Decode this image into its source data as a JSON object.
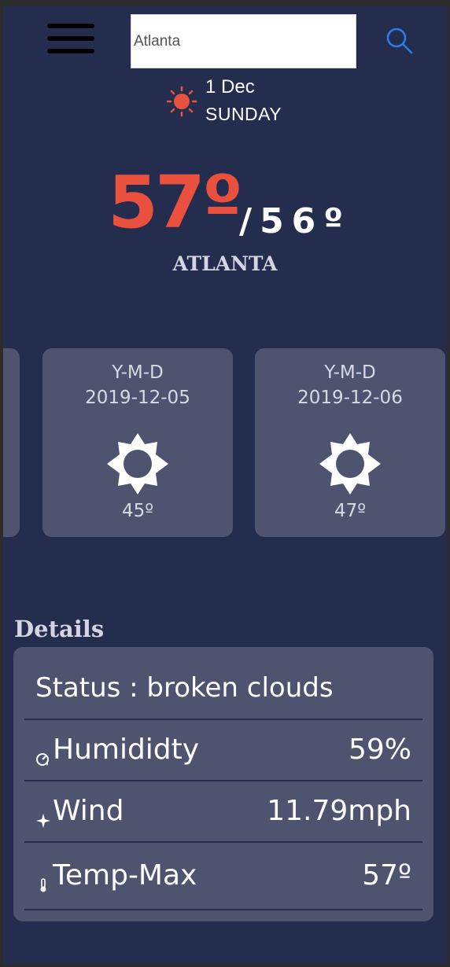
{
  "header": {
    "menu_icon": "hamburger-menu-icon",
    "search_value": "Atlanta",
    "search_icon": "search-icon"
  },
  "today": {
    "icon": "sun-icon",
    "day": "1 Dec",
    "weekday": "SUNDAY",
    "temp_current": "57º",
    "temp_min": "/56º",
    "city": "ATLANTA"
  },
  "forecast": [
    {
      "label": "Y-M-D",
      "date": "2019-12-05",
      "icon": "sun-icon",
      "temp": "45º"
    },
    {
      "label": "Y-M-D",
      "date": "2019-12-06",
      "icon": "sun-icon",
      "temp": "47º"
    }
  ],
  "details": {
    "title": "Details",
    "status": "Status : broken clouds",
    "rows": [
      {
        "icon": "humidity-gauge-icon",
        "label": "Humididty",
        "value": "59%"
      },
      {
        "icon": "wind-icon",
        "label": "Wind",
        "value": "11.79mph"
      },
      {
        "icon": "thermometer-icon",
        "label": "Temp-Max",
        "value": "57º"
      }
    ]
  },
  "colors": {
    "background": "#252d4e",
    "card": "#4e5470",
    "accent_temp": "#e9503d",
    "search_icon": "#2b7de9"
  }
}
